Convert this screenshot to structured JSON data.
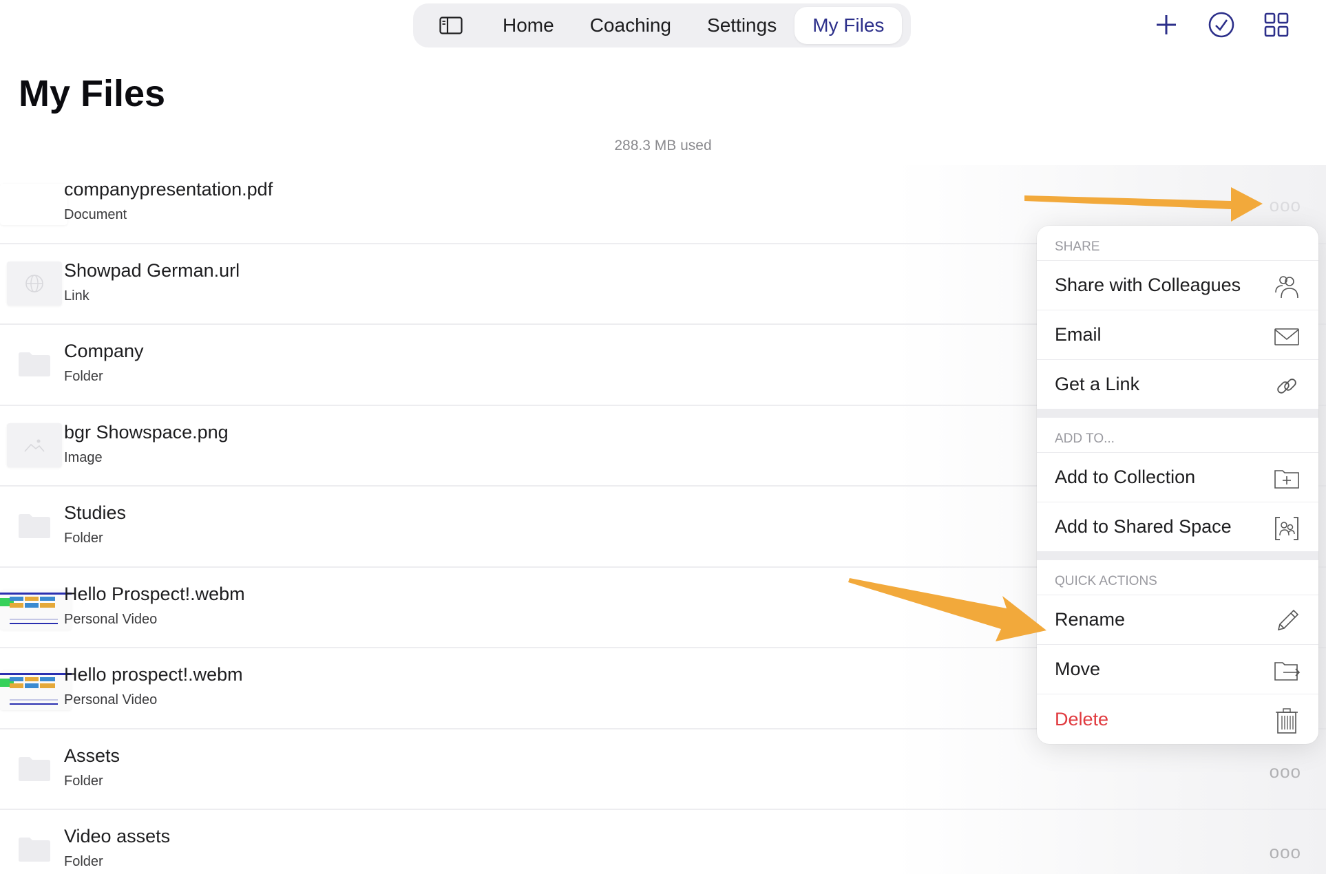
{
  "nav": {
    "tabs": [
      {
        "label": "Home"
      },
      {
        "label": "Coaching"
      },
      {
        "label": "Settings"
      },
      {
        "label": "My Files"
      }
    ],
    "active_tab": "My Files"
  },
  "top_actions": [
    "plus-icon",
    "checkmark-circle-icon",
    "grid-icon"
  ],
  "page": {
    "title": "My Files",
    "storage_used": "288.3 MB used"
  },
  "files": [
    {
      "name": "companypresentation.pdf",
      "type": "Document"
    },
    {
      "name": "Showpad German.url",
      "type": "Link"
    },
    {
      "name": "Company",
      "type": "Folder"
    },
    {
      "name": "bgr Showspace.png",
      "type": "Image"
    },
    {
      "name": "Studies",
      "type": "Folder"
    },
    {
      "name": "Hello Prospect!.webm",
      "type": "Personal Video"
    },
    {
      "name": "Hello prospect!.webm",
      "type": "Personal Video"
    },
    {
      "name": "Assets",
      "type": "Folder"
    },
    {
      "name": "Video assets",
      "type": "Folder"
    }
  ],
  "more_label": "ooo",
  "menu": {
    "share_head": "SHARE",
    "share_with_colleagues": "Share with Colleagues",
    "email": "Email",
    "get_link": "Get a Link",
    "add_to_head": "ADD TO...",
    "add_to_collection": "Add to Collection",
    "add_to_shared_space": "Add to Shared Space",
    "quick_actions_head": "QUICK ACTIONS",
    "rename": "Rename",
    "move": "Move",
    "delete": "Delete"
  },
  "colors": {
    "accent": "#2c2f8a",
    "danger": "#e0393e",
    "arrow": "#f2a93b"
  }
}
